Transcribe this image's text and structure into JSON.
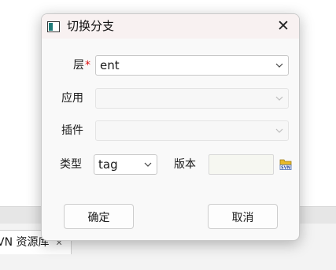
{
  "background": {
    "tab_label": "VN 资源库",
    "tab_close_glyph": "✕"
  },
  "dialog": {
    "title": "切换分支",
    "icon": "app-window-icon",
    "close_glyph": "✕",
    "fields": {
      "layer": {
        "label": "层",
        "required_mark": "*",
        "value": "ent"
      },
      "application": {
        "label": "应用",
        "value": ""
      },
      "plugin": {
        "label": "插件",
        "value": ""
      },
      "type": {
        "label": "类型",
        "value": "tag"
      },
      "version": {
        "label": "版本",
        "value": "",
        "browse_icon": "svn-browse-icon"
      }
    },
    "buttons": {
      "ok": "确定",
      "cancel": "取消"
    },
    "colors": {
      "required": "#dd1111",
      "titlebar": "#f8f1f1"
    }
  }
}
